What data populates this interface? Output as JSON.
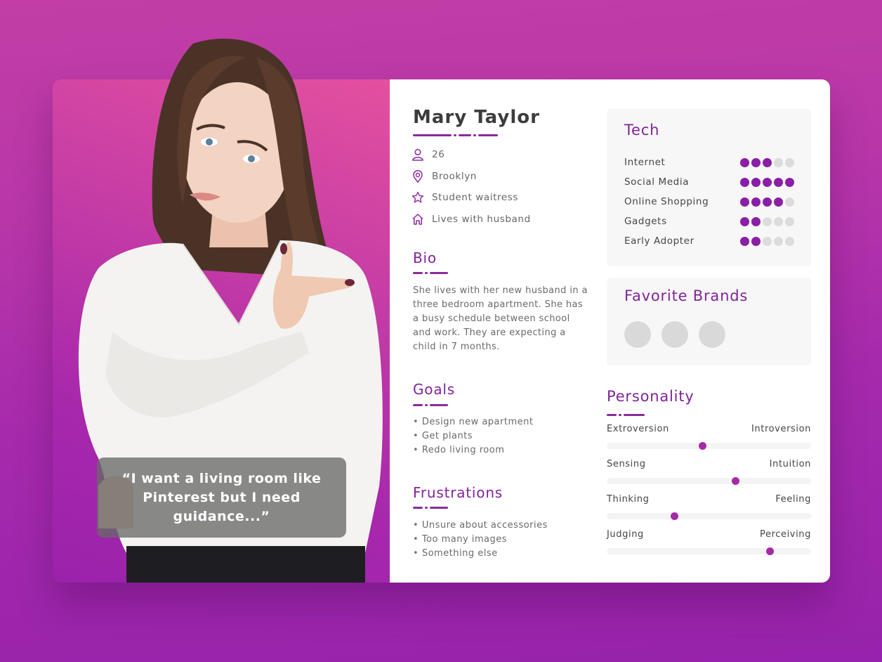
{
  "persona": {
    "name": "Mary Taylor",
    "photo_alt": "Smiling woman in white blouse pointing right",
    "quote": "“I want a living room like Pinterest but I need guidance...”",
    "info": [
      {
        "icon": "person-icon",
        "text": "26"
      },
      {
        "icon": "location-pin-icon",
        "text": "Brooklyn"
      },
      {
        "icon": "star-icon",
        "text": "Student waitress"
      },
      {
        "icon": "home-icon",
        "text": "Lives with husband"
      }
    ]
  },
  "bio": {
    "title": "Bio",
    "text": "She lives with her new husband in a three bedroom apartment. She has a busy schedule between school and work. They are expecting a child in 7 months."
  },
  "goals": {
    "title": "Goals",
    "items": [
      "Design new apartment",
      "Get plants",
      "Redo living room"
    ]
  },
  "frustrations": {
    "title": "Frustrations",
    "items": [
      "Unsure about accessories",
      "Too many images",
      "Something else"
    ]
  },
  "tech": {
    "title": "Tech",
    "max": 5,
    "items": [
      {
        "label": "Internet",
        "rating": 3
      },
      {
        "label": "Social Media",
        "rating": 5
      },
      {
        "label": "Online Shopping",
        "rating": 4
      },
      {
        "label": "Gadgets",
        "rating": 2
      },
      {
        "label": "Early Adopter",
        "rating": 2
      }
    ]
  },
  "brands": {
    "title": "Favorite Brands",
    "count": 3
  },
  "personality": {
    "title": "Personality",
    "traits": [
      {
        "left": "Extroversion",
        "right": "Introversion",
        "value": 0.47
      },
      {
        "left": "Sensing",
        "right": "Intuition",
        "value": 0.63
      },
      {
        "left": "Thinking",
        "right": "Feeling",
        "value": 0.33
      },
      {
        "left": "Judging",
        "right": "Perceiving",
        "value": 0.8
      }
    ]
  },
  "colors": {
    "accent": "#80249a",
    "rating_on": "#8a1ea6",
    "rating_off": "#dcdcdc",
    "slider_knob": "#a52aa6",
    "background_top": "#c23ea6",
    "background_bottom": "#9722ab"
  }
}
